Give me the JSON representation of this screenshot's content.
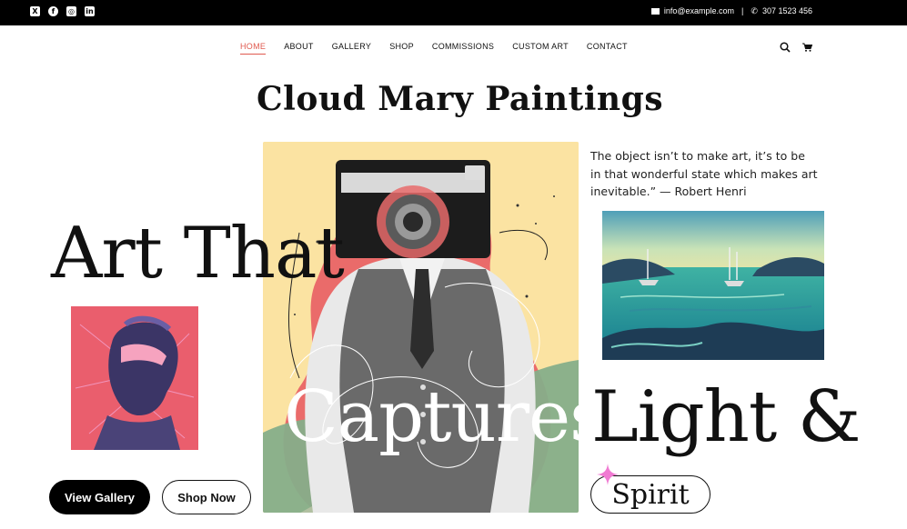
{
  "topbar": {
    "social": [
      {
        "icon": "x-twitter-icon",
        "glyph": "X"
      },
      {
        "icon": "facebook-icon",
        "glyph": "f"
      },
      {
        "icon": "instagram-icon",
        "glyph": "◎"
      },
      {
        "icon": "linkedin-icon",
        "glyph": "in"
      }
    ],
    "email": "info@example.com",
    "separator": "|",
    "phone": "307 1523 456"
  },
  "nav": {
    "items": [
      "HOME",
      "ABOUT",
      "GALLERY",
      "SHOP",
      "COMMISSIONS",
      "CUSTOM ART",
      "CONTACT"
    ],
    "active_index": 0
  },
  "site_title": "Cloud Mary Paintings",
  "quote": "The object isn’t to make art, it’s to be in that wonderful state which makes art inevitable.” — Robert Henri",
  "headline": {
    "line1": "Art That",
    "line2a": "Captures",
    "line2b": "Light &",
    "line3": "Spirit"
  },
  "buttons": {
    "gallery": "View Gallery",
    "shop": "Shop Now"
  },
  "colors": {
    "accent": "#e05a4f",
    "topbar": "#000000",
    "sparkle": "#f07ad2"
  }
}
